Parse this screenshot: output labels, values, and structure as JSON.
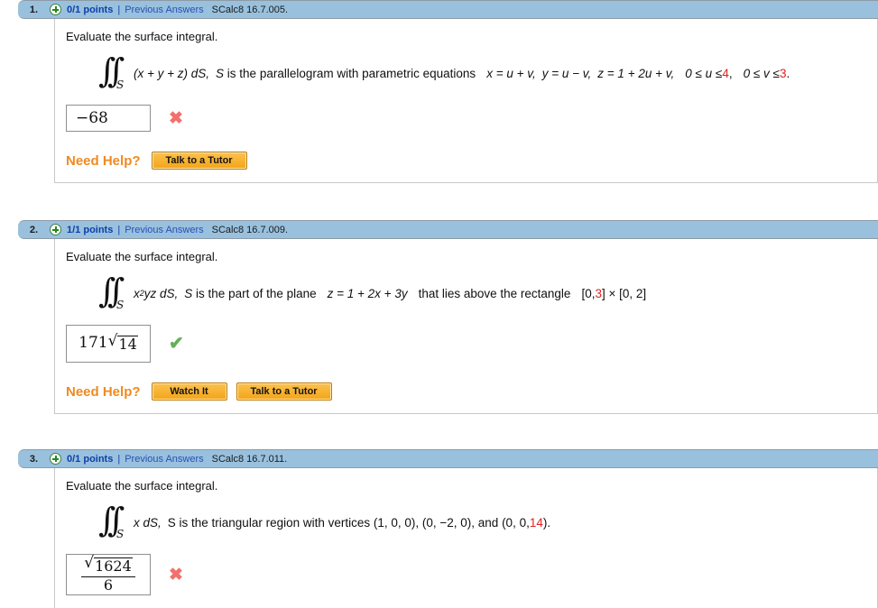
{
  "page": {
    "prompt_text": "Evaluate the surface integral.",
    "help_label": "Need Help?",
    "separator": "|",
    "plus_icon": "plus-circle-icon",
    "correct_icon": "checkmark-icon",
    "incorrect_icon": "cross-icon",
    "correct_glyph": "✔",
    "incorrect_glyph": "✖",
    "colors": {
      "header_bar": "#99c1de",
      "points_text": "#0e3fa8",
      "link": "#2a4fb5",
      "randomized_value": "#e02020",
      "help_label": "#f08a1e",
      "button": "#f2a518",
      "correct": "#62b155",
      "incorrect": "#f2706e"
    }
  },
  "problems": [
    {
      "number": "1.",
      "points": "0/1 points",
      "previous_answers": "Previous Answers",
      "source": "SCalc8 16.7.005.",
      "prompt": "Evaluate the surface integral.",
      "integral_subscript": "S",
      "integrand": "(x + y + z) dS,",
      "description_lead": "S is the parallelogram with parametric equations",
      "equations": [
        {
          "lhs": "x",
          "rhs": "= u + v,"
        },
        {
          "lhs": "y",
          "rhs": "= u − v,"
        },
        {
          "lhs": "z",
          "rhs": "= 1 + 2u + v,"
        }
      ],
      "bounds": [
        {
          "prefix": "0 ≤ u ≤ ",
          "value": "4",
          "suffix": ","
        },
        {
          "prefix": "0 ≤ v ≤ ",
          "value": "3",
          "suffix": "."
        }
      ],
      "answer": {
        "display": "−68",
        "type": "plain"
      },
      "status": "incorrect",
      "help_buttons": [
        "Talk to a Tutor"
      ]
    },
    {
      "number": "2.",
      "points": "1/1 points",
      "previous_answers": "Previous Answers",
      "source": "SCalc8 16.7.009.",
      "prompt": "Evaluate the surface integral.",
      "integral_subscript": "S",
      "integrand_base": "x",
      "integrand_exp": "2",
      "integrand_rest": "yz dS,",
      "description_lead": "S is the part of the plane",
      "plane_equation": "z = 1 + 2x + 3y",
      "description_tail": "that lies above the rectangle",
      "rectangle": {
        "prefix": "[0, ",
        "value": "3",
        "middle": "] × [0, 2]"
      },
      "answer": {
        "type": "radical",
        "coefficient": "171",
        "radicand": "14",
        "display": "171√14"
      },
      "status": "correct",
      "help_buttons": [
        "Watch It",
        "Talk to a Tutor"
      ]
    },
    {
      "number": "3.",
      "points": "0/1 points",
      "previous_answers": "Previous Answers",
      "source": "SCalc8 16.7.011.",
      "prompt": "Evaluate the surface integral.",
      "integral_subscript": "S",
      "integrand": "x dS,",
      "description_lead": "S is the triangular region with vertices (1, 0, 0), (0, −2, 0), and (0, 0, ",
      "vertex_value": "14",
      "description_tail": ").",
      "answer": {
        "type": "fraction",
        "numerator_radicand": "1624",
        "denominator": "6",
        "display": "√1624 / 6"
      },
      "status": "incorrect",
      "help_buttons": []
    }
  ]
}
